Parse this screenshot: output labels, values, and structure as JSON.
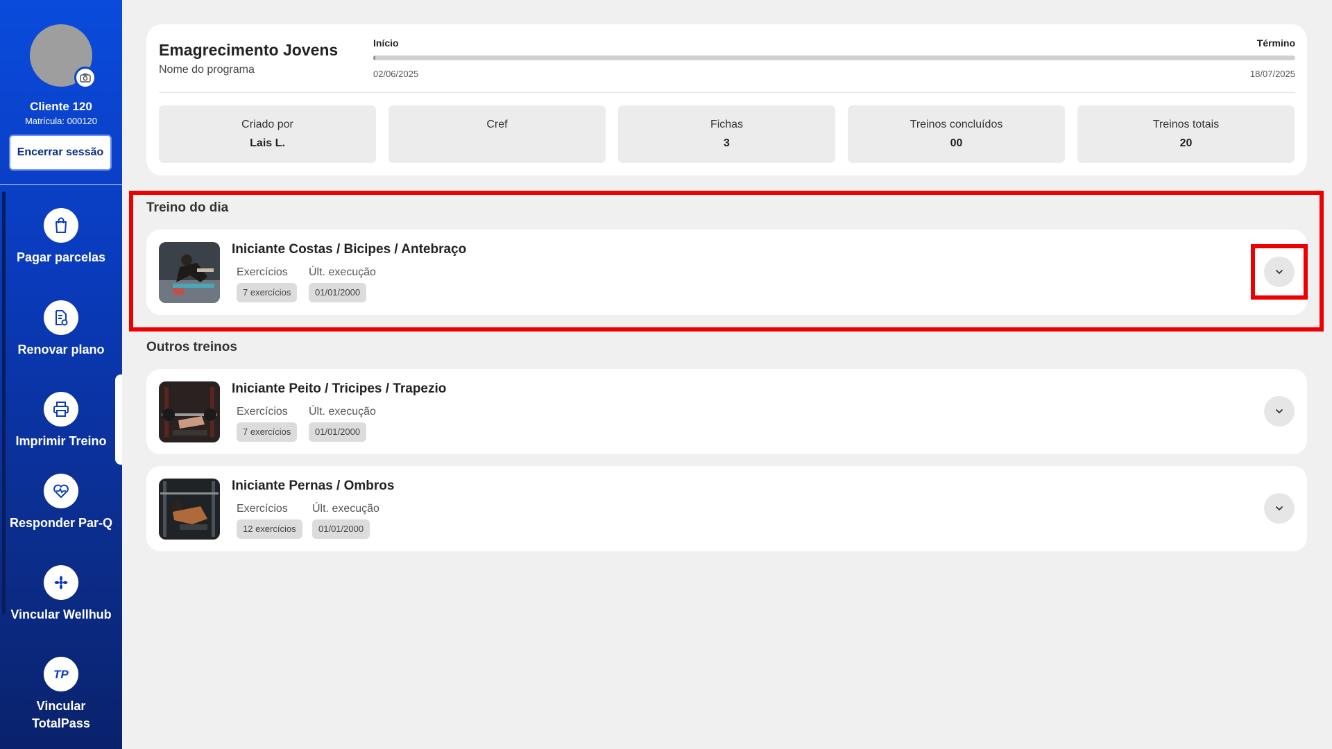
{
  "sidebar": {
    "client_name": "Cliente 120",
    "client_registration": "Matrícula: 000120",
    "logout_label": "Encerrar sessão",
    "items": [
      {
        "label": "Pagar parcelas",
        "icon": "shopping-bag-icon"
      },
      {
        "label": "Renovar plano",
        "icon": "document-refresh-icon"
      },
      {
        "label": "Imprimir Treino",
        "icon": "printer-icon"
      },
      {
        "label": "Responder Par-Q",
        "icon": "heart-pulse-icon"
      },
      {
        "label": "Vincular Wellhub",
        "icon": "wellhub-logo-icon"
      },
      {
        "label": "Vincular TotalPass",
        "icon": "totalpass-logo-icon"
      }
    ],
    "active_item": "Imprimir Treino"
  },
  "program": {
    "title": "Emagrecimento Jovens",
    "subtitle": "Nome do programa",
    "start_label": "Início",
    "end_label": "Término",
    "start_date": "02/06/2025",
    "end_date": "18/07/2025",
    "progress": 0.0,
    "stats": [
      {
        "label": "Criado por",
        "value": "Lais L."
      },
      {
        "label": "Cref",
        "value": ""
      },
      {
        "label": "Fichas",
        "value": "3"
      },
      {
        "label": "Treinos concluídos",
        "value": "00"
      },
      {
        "label": "Treinos totais",
        "value": "20"
      }
    ]
  },
  "today_section": {
    "title": "Treino do dia",
    "workouts": [
      {
        "name": "Iniciante Costas / Bicipes / Antebraço",
        "exercises_label": "Exercícios",
        "last_exec_label": "Últ. execução",
        "exercises_value": "7 exercícios",
        "last_exec_value": "01/01/2000"
      }
    ]
  },
  "other_section": {
    "title": "Outros treinos",
    "workouts": [
      {
        "name": "Iniciante Peito / Tricipes / Trapezio",
        "exercises_label": "Exercícios",
        "last_exec_label": "Últ. execução",
        "exercises_value": "7 exercícios",
        "last_exec_value": "01/01/2000"
      },
      {
        "name": "Iniciante Pernas / Ombros",
        "exercises_label": "Exercícios",
        "last_exec_label": "Últ. execução",
        "exercises_value": "12 exercícios",
        "last_exec_value": "01/01/2000"
      }
    ]
  },
  "colors": {
    "sidebar_top": "#0a4bdc",
    "sidebar_bottom": "#0a226c",
    "highlight": "#ee0000",
    "background": "#f0f0f0"
  }
}
